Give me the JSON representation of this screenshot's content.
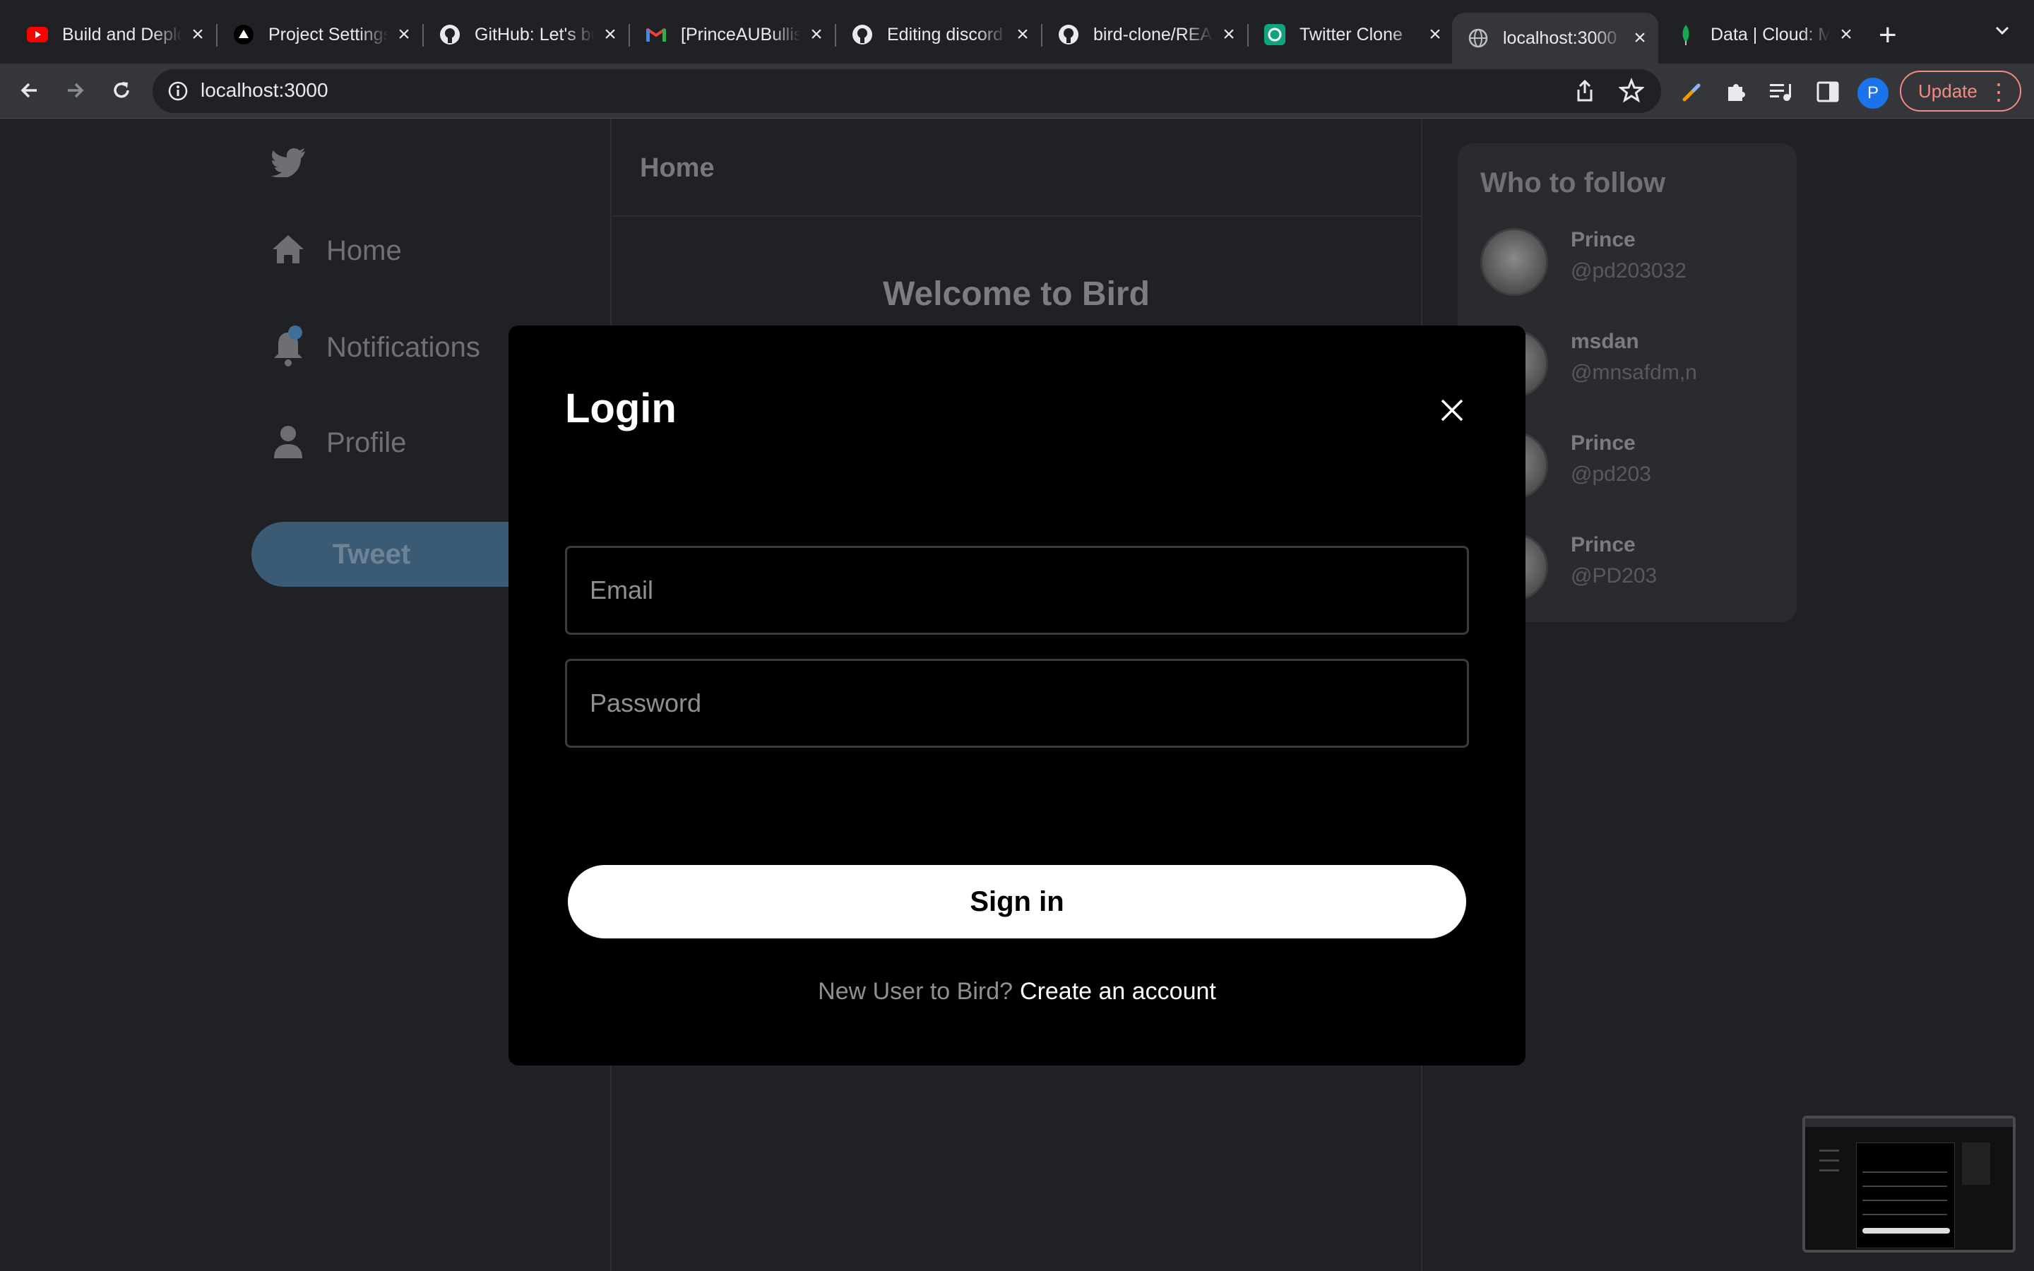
{
  "browser": {
    "tabs": [
      {
        "title": "Build and Deploy",
        "icon": "youtube-icon"
      },
      {
        "title": "Project Settings",
        "icon": "vercel-icon"
      },
      {
        "title": "GitHub: Let's build",
        "icon": "github-icon"
      },
      {
        "title": "[PrinceAUBullish",
        "icon": "gmail-icon"
      },
      {
        "title": "Editing discord",
        "icon": "github-icon"
      },
      {
        "title": "bird-clone/README",
        "icon": "github-icon"
      },
      {
        "title": "Twitter Clone",
        "icon": "openai-icon"
      },
      {
        "title": "localhost:3000",
        "icon": "globe-icon",
        "active": true
      },
      {
        "title": "Data | Cloud: MongoDB",
        "icon": "mongodb-leaf-icon"
      }
    ],
    "url": "localhost:3000",
    "profile_initial": "P",
    "update_label": "Update",
    "colors": {
      "update_accent": "#f28b82",
      "profile": "#1a73e8"
    }
  },
  "app": {
    "sidebar": {
      "logo_icon": "twitter-bird-icon",
      "items": [
        {
          "label": "Home",
          "icon": "home-icon"
        },
        {
          "label": "Notifications",
          "icon": "bell-icon"
        },
        {
          "label": "Profile",
          "icon": "user-icon"
        }
      ],
      "tweet_label": "Tweet"
    },
    "feed": {
      "header": "Home",
      "welcome": "Welcome to Bird"
    },
    "who_to_follow": {
      "title": "Who to follow",
      "users": [
        {
          "name": "Prince",
          "handle": "@pd203032"
        },
        {
          "name": "msdan",
          "handle": "@mnsafdm,n"
        },
        {
          "name": "Prince",
          "handle": "@pd203"
        },
        {
          "name": "Prince",
          "handle": "@PD203"
        }
      ]
    }
  },
  "login_modal": {
    "title": "Login",
    "email_placeholder": "Email",
    "password_placeholder": "Password",
    "submit_label": "Sign in",
    "footer_question": "New User to Bird?",
    "footer_link": "Create an account"
  }
}
